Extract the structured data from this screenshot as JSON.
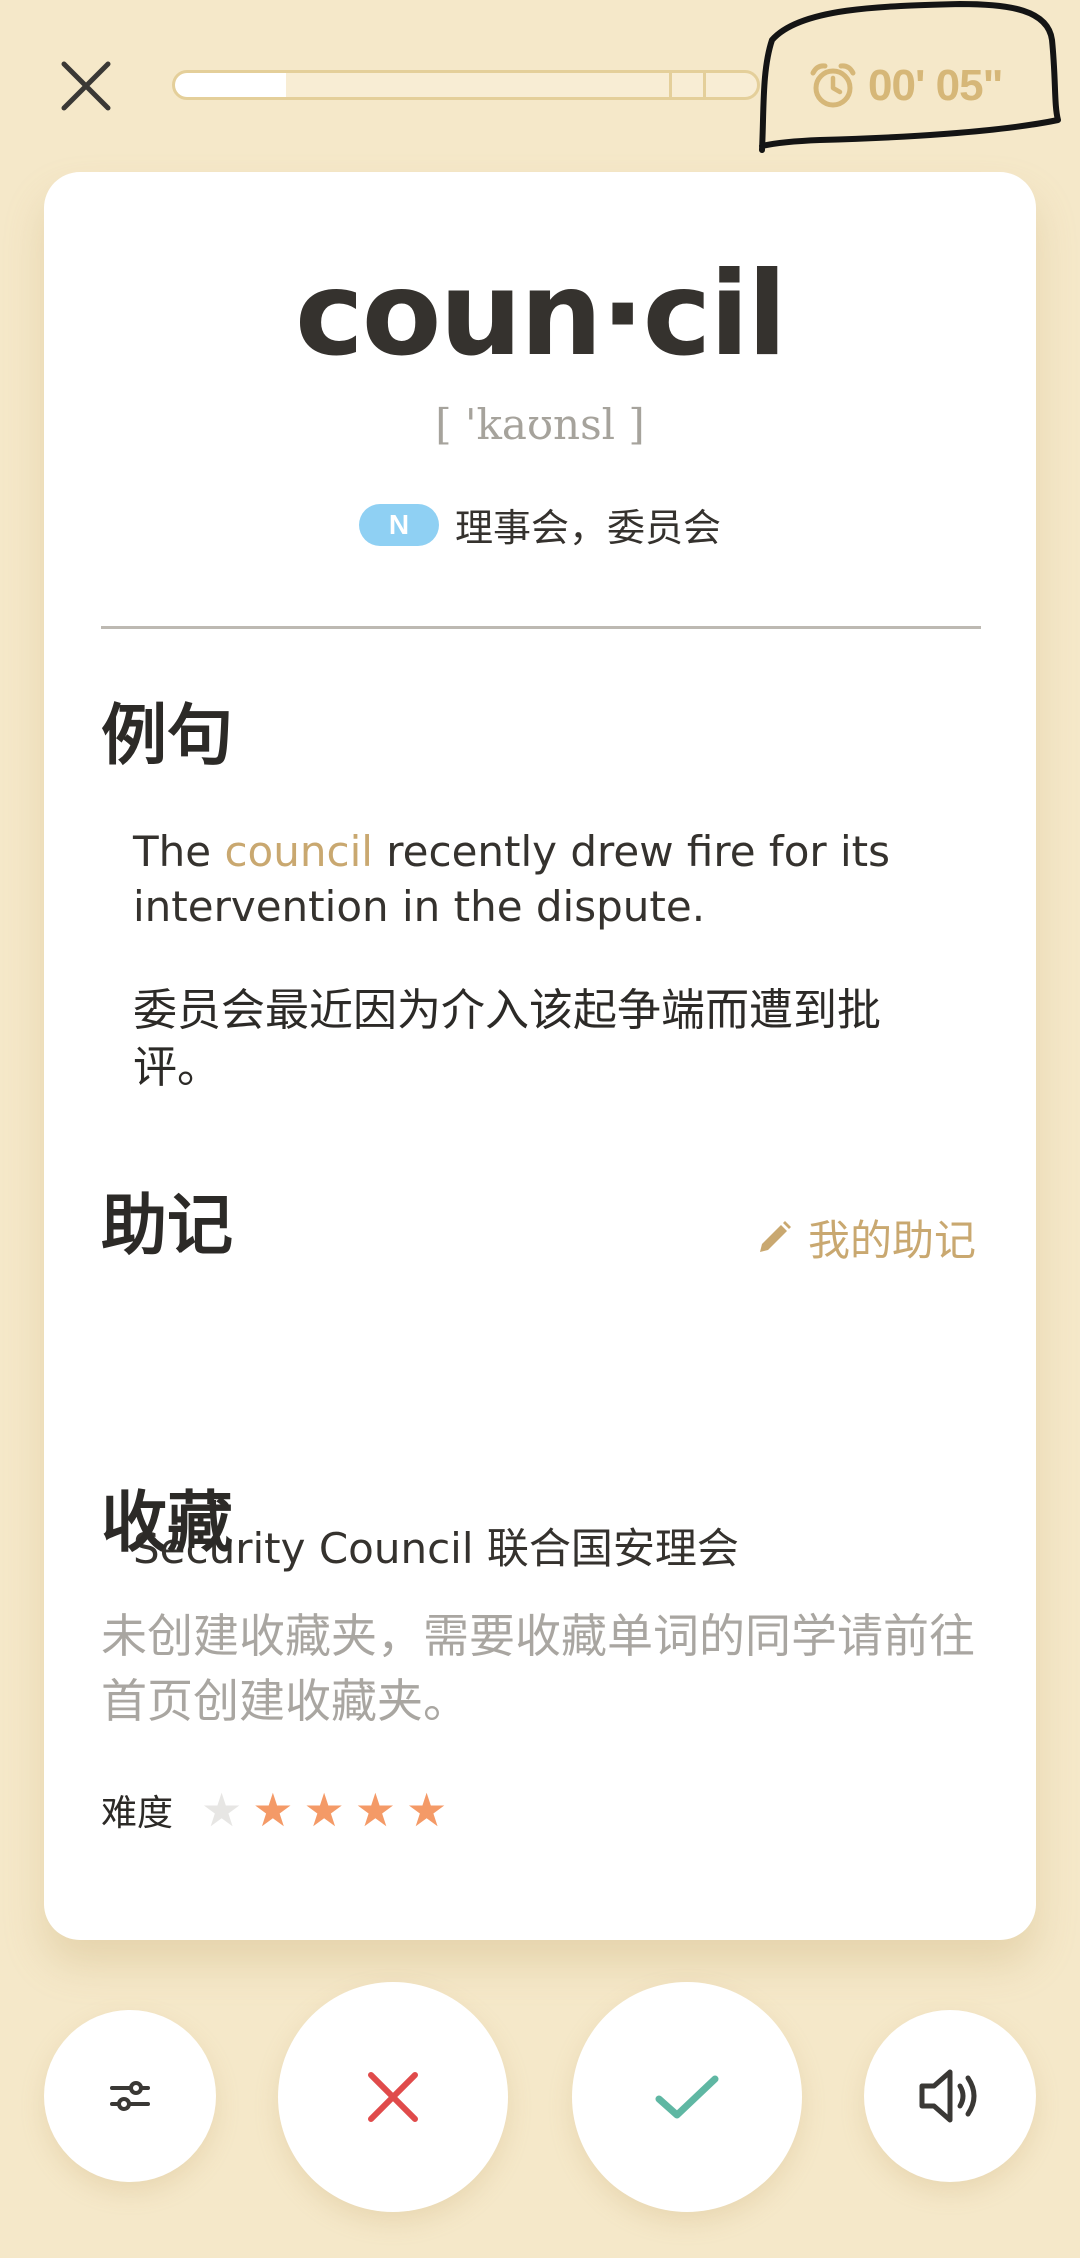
{
  "header": {
    "timer": "00' 05\"",
    "progress": 0.19
  },
  "word": {
    "headword": "coun·cil",
    "phonetic": "[ 'kaʊnsl ]",
    "pos": "N",
    "definition": "理事会，委员会"
  },
  "example": {
    "title": "例句",
    "en_before": "The ",
    "en_highlight": "council",
    "en_after": " recently drew fire for its intervention in the dispute.",
    "zh": "委员会最近因为介入该起争端而遭到批评。"
  },
  "mnemonic": {
    "title": "助记",
    "my_label": "我的助记",
    "text": "Security Council 联合国安理会"
  },
  "favorites": {
    "title": "收藏",
    "note": "未创建收藏夹，需要收藏单词的同学请前往首页创建收藏夹。"
  },
  "difficulty": {
    "label": "难度",
    "rating": 4,
    "max": 5
  },
  "colors": {
    "background": "#f5e8c9",
    "accent": "#c9a870",
    "badge": "#8fd0f3",
    "star": "#f49a67",
    "wrong": "#e04b4b",
    "correct": "#5fb7a3"
  },
  "icons": {
    "close": "close-icon",
    "timer": "alarm-clock-icon",
    "edit": "pencil-icon",
    "settings": "sliders-icon",
    "wrong": "x-icon",
    "correct": "check-icon",
    "audio": "speaker-icon"
  }
}
